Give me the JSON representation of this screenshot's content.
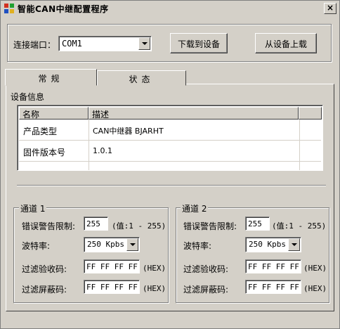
{
  "window": {
    "title": "智能CAN中继配置程序",
    "close_label": "×"
  },
  "connection": {
    "port_label": "连接端口：",
    "port_value": "COM1",
    "download_label": "下载到设备",
    "upload_label": "从设备上载"
  },
  "tabs": [
    {
      "label": "常规",
      "active": true
    },
    {
      "label": "状态",
      "active": false
    }
  ],
  "device_info": {
    "section_label": "设备信息",
    "columns": [
      "名称",
      "描述"
    ],
    "rows": [
      [
        "产品类型",
        "CAN中继器 BJARHT"
      ],
      [
        "固件版本号",
        "1.0.1"
      ]
    ]
  },
  "channels": [
    {
      "title": "通道 1",
      "warn_label": "错误警告限制:",
      "warn_value": "255",
      "warn_hint": "(值:1 - 255)",
      "baud_label": "波特率:",
      "baud_value": "250  Kpbs",
      "acc_code_label": "过滤验收码:",
      "acc_code_value": "FF FF FF FF",
      "acc_code_unit": "(HEX)",
      "mask_label": "过滤屏蔽码:",
      "mask_value": "FF FF FF FF",
      "mask_unit": "(HEX)"
    },
    {
      "title": "通道 2",
      "warn_label": "错误警告限制:",
      "warn_value": "255",
      "warn_hint": "(值:1 - 255)",
      "baud_label": "波特率:",
      "baud_value": "250  Kpbs",
      "acc_code_label": "过滤验收码:",
      "acc_code_value": "FF FF FF FF",
      "acc_code_unit": "(HEX)",
      "mask_label": "过滤屏蔽码:",
      "mask_value": "FF FF FF FF",
      "mask_unit": "(HEX)"
    }
  ]
}
